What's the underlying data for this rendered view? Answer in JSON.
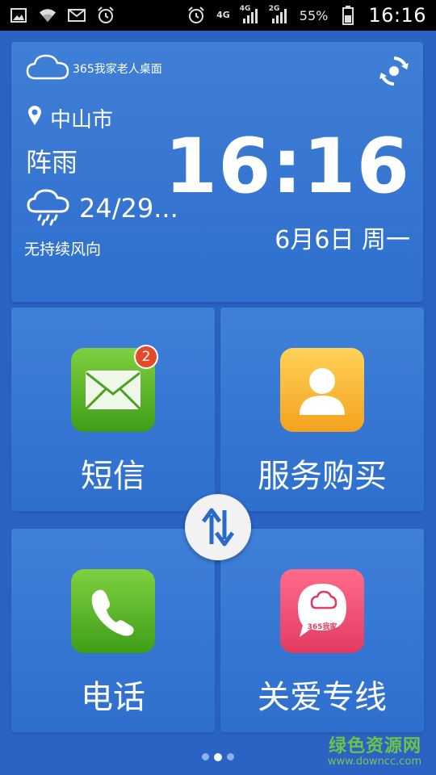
{
  "status_bar": {
    "net_type": "4G",
    "sim1_label": "4G",
    "sim2_label": "2G",
    "battery_percent": "55%",
    "time": "16:16",
    "icons": [
      "image-icon",
      "wifi-icon",
      "mail-icon",
      "alarm-icon",
      "alarm-icon",
      "signal-icon",
      "battery-icon"
    ]
  },
  "weather": {
    "brand": "365我家老人桌面",
    "city": "中山市",
    "condition": "阵雨",
    "temp": "24/29...",
    "wind": "无持续风向",
    "time": "16:16",
    "date": "6月6日 周一"
  },
  "tiles": {
    "sms": {
      "label": "短信",
      "badge": "2"
    },
    "service": {
      "label": "服务购买"
    },
    "phone": {
      "label": "电话"
    },
    "care": {
      "label": "关爱专线",
      "icon_text": "365我家"
    }
  },
  "pager": {
    "count": 3,
    "active_index": 1
  },
  "watermark": {
    "title": "绿色资源网",
    "url": "www.downcc.com"
  },
  "colors": {
    "background": "#2a63c4",
    "tile": "#3a7ad6",
    "green": "#4eb022",
    "orange": "#f6b233",
    "pink": "#ef4d70"
  }
}
